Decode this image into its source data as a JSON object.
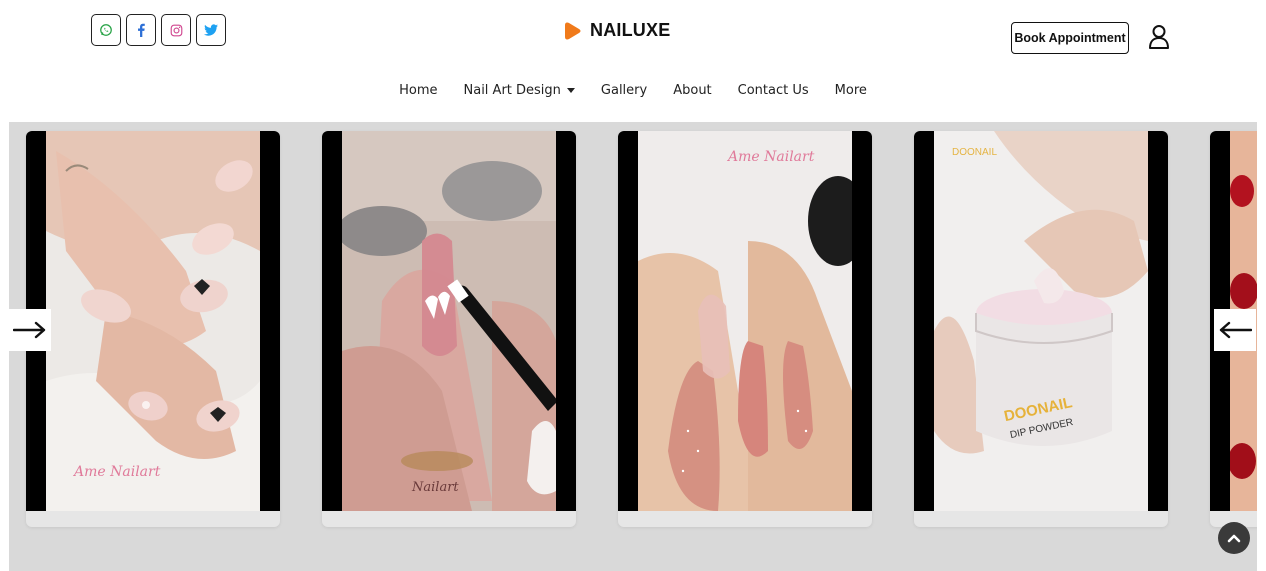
{
  "header": {
    "social": [
      {
        "name": "whatsapp-icon",
        "color": "#25a244"
      },
      {
        "name": "facebook-icon",
        "color": "#2d6fd6"
      },
      {
        "name": "instagram-icon",
        "color": "#d0468f"
      },
      {
        "name": "twitter-icon",
        "color": "#1da1f2"
      }
    ],
    "brand": {
      "name": "NAILUXE",
      "accent": "#f07a1a"
    },
    "book_label": "Book Appointment",
    "user_icon": "user-icon"
  },
  "nav": {
    "items": [
      {
        "label": "Home"
      },
      {
        "label": "Nail Art Design",
        "has_dropdown": true
      },
      {
        "label": "Gallery"
      },
      {
        "label": "About"
      },
      {
        "label": "Contact Us"
      },
      {
        "label": "More"
      }
    ]
  },
  "gallery": {
    "cards": [
      {
        "name": "gallery-card-1",
        "subject": "nail-art-hearts-photo"
      },
      {
        "name": "gallery-card-2",
        "subject": "nail-painting-brush-photo"
      },
      {
        "name": "gallery-card-3",
        "subject": "glitter-almond-nails-photo"
      },
      {
        "name": "gallery-card-4",
        "subject": "dip-powder-jar-photo",
        "jar_text": [
          "DOONAIL",
          "DIP POWDER"
        ]
      }
    ],
    "prev_arrow": "arrow-right-icon",
    "next_arrow": "arrow-left-icon",
    "background": "#d9d9d9"
  },
  "scroll_top_icon": "chevron-up-icon"
}
